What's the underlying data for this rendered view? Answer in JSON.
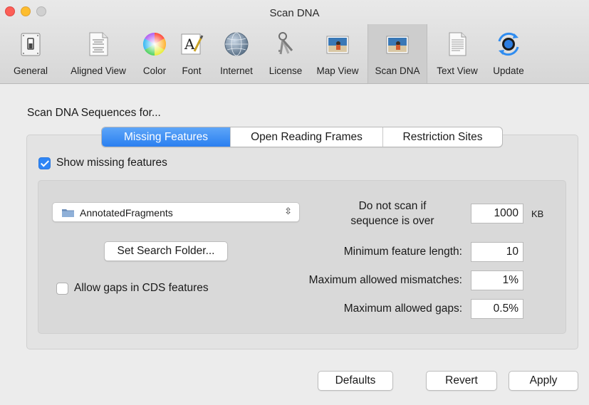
{
  "window": {
    "title": "Scan DNA"
  },
  "toolbar": {
    "items": [
      {
        "label": "General",
        "icon": "switch-icon"
      },
      {
        "label": "Aligned View",
        "icon": "aligned-document-icon"
      },
      {
        "label": "Color",
        "icon": "color-wheel-icon"
      },
      {
        "label": "Font",
        "icon": "font-icon"
      },
      {
        "label": "Internet",
        "icon": "globe-icon"
      },
      {
        "label": "License",
        "icon": "keys-icon"
      },
      {
        "label": "Map View",
        "icon": "map-view-icon"
      },
      {
        "label": "Scan DNA",
        "icon": "scan-dna-icon",
        "selected": true
      },
      {
        "label": "Text View",
        "icon": "text-document-icon"
      },
      {
        "label": "Update",
        "icon": "update-icon"
      }
    ]
  },
  "main": {
    "section_title": "Scan DNA Sequences for...",
    "tabs": [
      {
        "label": "Missing Features",
        "active": true
      },
      {
        "label": "Open Reading Frames",
        "active": false
      },
      {
        "label": "Restriction Sites",
        "active": false
      }
    ],
    "show_missing_features": {
      "label": "Show missing features",
      "checked": true
    },
    "folder_popup": {
      "value": "AnnotatedFragments"
    },
    "set_search_folder_label": "Set Search Folder...",
    "allow_gaps": {
      "label": "Allow gaps in CDS features",
      "checked": false
    },
    "scan_limit": {
      "label_line1": "Do not scan if",
      "label_line2": "sequence is over",
      "value": "1000",
      "unit": "KB"
    },
    "min_feature_length": {
      "label": "Minimum feature length:",
      "value": "10"
    },
    "max_mismatches": {
      "label": "Maximum allowed mismatches:",
      "value": "1%"
    },
    "max_gaps": {
      "label": "Maximum allowed gaps:",
      "value": "0.5%"
    }
  },
  "footer": {
    "defaults_label": "Defaults",
    "revert_label": "Revert",
    "apply_label": "Apply"
  },
  "colors": {
    "accent": "#2f86f5",
    "close": "#fc5f57",
    "minimize": "#fdbd2e"
  }
}
